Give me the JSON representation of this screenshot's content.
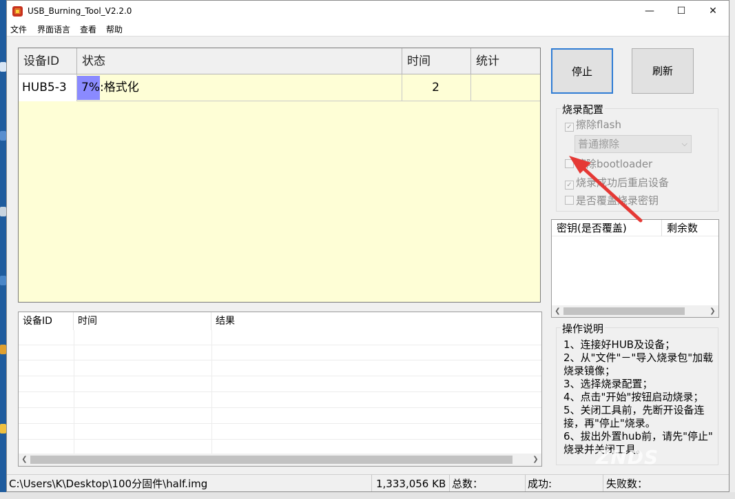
{
  "window": {
    "title": "USB_Burning_Tool_V2.2.0",
    "minimize": "—",
    "maximize": "☐",
    "close": "✕"
  },
  "menu": [
    "文件",
    "界面语言",
    "查看",
    "帮助"
  ],
  "device_table": {
    "columns": [
      "设备ID",
      "状态",
      "时间",
      "统计"
    ],
    "rows": [
      {
        "device_id": "HUB5-3",
        "progress_percent": 7,
        "status": "7%:格式化",
        "time": "2",
        "stats": ""
      }
    ]
  },
  "result_table": {
    "columns": [
      "设备ID",
      "时间",
      "结果"
    ],
    "rows": []
  },
  "buttons": {
    "stop": "停止",
    "refresh": "刷新"
  },
  "burn_config": {
    "title": "烧录配置",
    "erase_flash": {
      "label": "擦除flash",
      "checked": true
    },
    "erase_mode": "普通擦除",
    "erase_bootloader": {
      "label": "擦除bootloader",
      "checked": false
    },
    "reboot_after_success": {
      "label": "烧录成功后重启设备",
      "checked": true
    },
    "overwrite_key": {
      "label": "是否覆盖烧录密钥",
      "checked": false
    }
  },
  "key_table": {
    "columns": [
      "密钥(是否覆盖)",
      "剩余数"
    ]
  },
  "instructions": {
    "title": "操作说明",
    "lines": [
      "1、连接好HUB及设备；",
      "2、从\"文件\"－\"导入烧录包\"加载",
      "烧录镜像；",
      "3、选择烧录配置；",
      "4、点击\"开始\"按钮启动烧录；",
      "5、关闭工具前，先断开设备连",
      "接，再\"停止\"烧录。",
      "6、拔出外置hub前，请先\"停止\"",
      "烧录并关闭工具。"
    ]
  },
  "status_bar": {
    "path": "C:\\Users\\K\\Desktop\\100分固件\\half.img",
    "size": "1,333,056 KB",
    "total": "总数：",
    "success": "成功:",
    "failed": "失败数："
  },
  "watermark": "ZNDS",
  "colors": {
    "progress": "#8a8aff",
    "row_bg": "#fefed6",
    "arrow": "#e53935",
    "focus": "#2e7bd4"
  }
}
